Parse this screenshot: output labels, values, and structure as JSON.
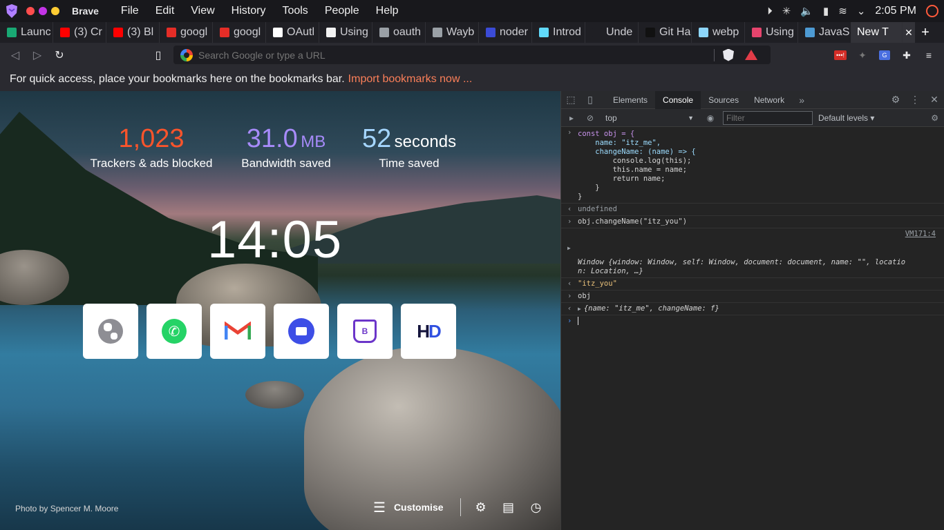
{
  "system": {
    "app_name": "Brave",
    "menu": [
      "File",
      "Edit",
      "View",
      "History",
      "Tools",
      "People",
      "Help"
    ],
    "time": "2:05 PM"
  },
  "tabs": [
    {
      "label": "Launc",
      "fav": "alt",
      "color": "#19a974"
    },
    {
      "label": "(3) Cr",
      "fav": "yt",
      "color": "#ff0000"
    },
    {
      "label": "(3) Bl",
      "fav": "yt",
      "color": "#ff0000"
    },
    {
      "label": "googl",
      "fav": "n",
      "color": "#e52d27"
    },
    {
      "label": "googl",
      "fav": "n",
      "color": "#e52d27"
    },
    {
      "label": "OAutl",
      "fav": "o",
      "color": "#ffffff"
    },
    {
      "label": "Using",
      "fav": "u",
      "color": "#f2f2f2"
    },
    {
      "label": "oauth",
      "fav": "gh",
      "color": "#9aa0a6"
    },
    {
      "label": "Wayb",
      "fav": "gh",
      "color": "#9aa0a6"
    },
    {
      "label": "noder",
      "fav": "sh",
      "color": "#3b4bd6"
    },
    {
      "label": "Introd",
      "fav": "re",
      "color": "#61dafb"
    },
    {
      "label": "Unde",
      "fav": "a",
      "color": "#1f1f24"
    },
    {
      "label": "Git Ha",
      "fav": "DEV",
      "color": "#111111"
    },
    {
      "label": "webp",
      "fav": "wp",
      "color": "#8ed6fb"
    },
    {
      "label": "Using",
      "fav": "ic",
      "color": "#e6446d"
    },
    {
      "label": "JavaS",
      "fav": "js",
      "color": "#4d9ad3"
    }
  ],
  "active_tab": {
    "label": "New T"
  },
  "urlbar": {
    "placeholder": "Search Google or type a URL"
  },
  "bookmarks_bar": {
    "text": "For quick access, place your bookmarks here on the bookmarks bar.",
    "link": "Import bookmarks now ..."
  },
  "ntp": {
    "stats": [
      {
        "value": "1,023",
        "unit": "",
        "label": "Trackers & ads blocked",
        "color": "#fb542b"
      },
      {
        "value": "31.0",
        "unit": "MB",
        "label": "Bandwidth saved",
        "color": "#a78bfa"
      },
      {
        "value": "52",
        "unit": "seconds",
        "label": "Time saved",
        "color": "#ffffff"
      }
    ],
    "clock": "14:05",
    "tiles": [
      "globe-icon",
      "whatsapp-icon",
      "gmail-icon",
      "meet-icon",
      "bank-icon",
      "hd-icon"
    ],
    "credit_prefix": "Photo by",
    "credit_name": "Spencer M. Moore",
    "customise": "Customise"
  },
  "devtools": {
    "tabs": [
      "Elements",
      "Console",
      "Sources",
      "Network"
    ],
    "active": "Console",
    "context": "top",
    "filter_placeholder": "Filter",
    "levels": "Default levels",
    "console": {
      "code": [
        "const obj = {",
        "    name: \"itz_me\",",
        "    changeName: (name) => {",
        "        console.log(this);",
        "        this.name = name;",
        "        return name;",
        "    }",
        "}"
      ],
      "undefined": "undefined",
      "call": "obj.changeName(\"itz_you\")",
      "source_link": "VM171:4",
      "window_line1": "Window {window: Window, self: Window, document: document, name: \"\", locatio",
      "window_line2": "n: Location, …}",
      "returned": "\"itz_you\"",
      "obj_cmd": "obj",
      "obj_result": "{name: \"itz_me\", changeName: f}"
    }
  }
}
